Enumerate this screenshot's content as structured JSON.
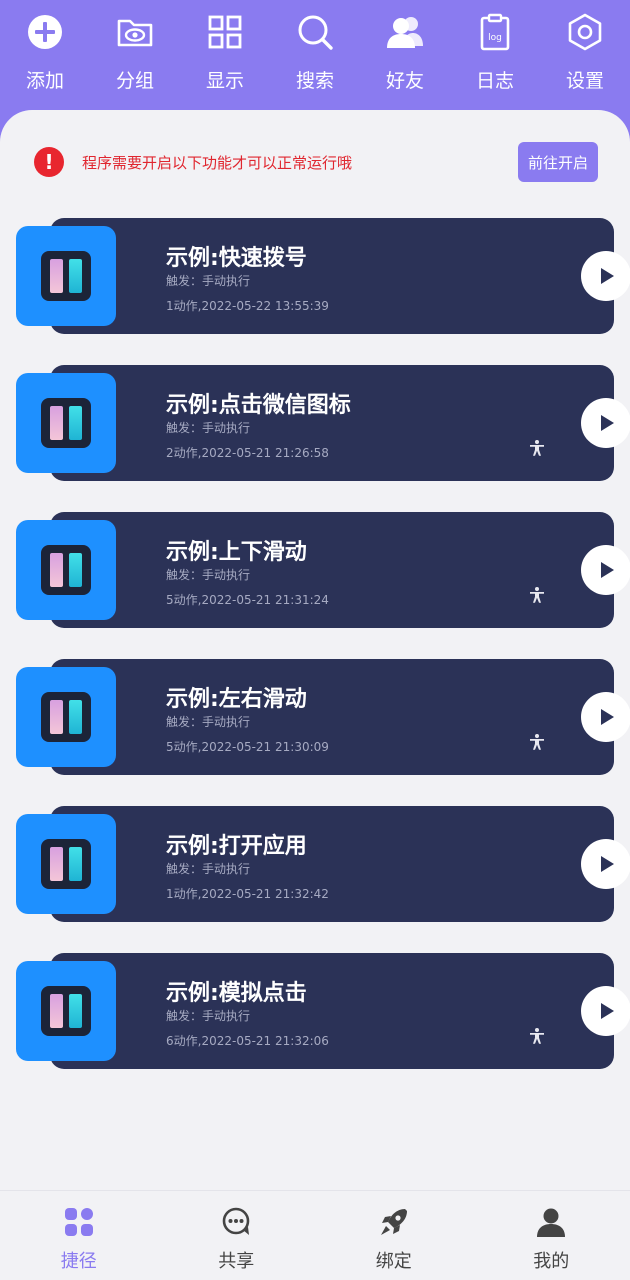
{
  "toolbar": {
    "items": [
      {
        "label": "添加",
        "icon": "plus-circle-icon"
      },
      {
        "label": "分组",
        "icon": "folder-eye-icon"
      },
      {
        "label": "显示",
        "icon": "grid-icon"
      },
      {
        "label": "搜索",
        "icon": "search-icon"
      },
      {
        "label": "好友",
        "icon": "friends-icon"
      },
      {
        "label": "日志",
        "icon": "log-clipboard-icon"
      },
      {
        "label": "设置",
        "icon": "settings-hexagon-icon"
      }
    ]
  },
  "notice": {
    "icon_text": "!",
    "text": "程序需要开启以下功能才可以正常运行哦",
    "button_label": "前往开启"
  },
  "cards": [
    {
      "title": "示例:快速拨号",
      "trigger": "触发：手动执行",
      "meta": "1动作,2022-05-22 13:55:39",
      "accessibility": false
    },
    {
      "title": "示例:点击微信图标",
      "trigger": "触发：手动执行",
      "meta": "2动作,2022-05-21 21:26:58",
      "accessibility": true
    },
    {
      "title": "示例:上下滑动",
      "trigger": "触发：手动执行",
      "meta": "5动作,2022-05-21 21:31:24",
      "accessibility": true
    },
    {
      "title": "示例:左右滑动",
      "trigger": "触发：手动执行",
      "meta": "5动作,2022-05-21 21:30:09",
      "accessibility": true
    },
    {
      "title": "示例:打开应用",
      "trigger": "触发：手动执行",
      "meta": "1动作,2022-05-21 21:32:42",
      "accessibility": false
    },
    {
      "title": "示例:模拟点击",
      "trigger": "触发：手动执行",
      "meta": "6动作,2022-05-21 21:32:06",
      "accessibility": true
    }
  ],
  "bottom_nav": {
    "items": [
      {
        "label": "捷径",
        "icon": "shortcuts-icon",
        "active": true
      },
      {
        "label": "共享",
        "icon": "share-chat-icon",
        "active": false
      },
      {
        "label": "绑定",
        "icon": "rocket-icon",
        "active": false
      },
      {
        "label": "我的",
        "icon": "profile-icon",
        "active": false
      }
    ]
  },
  "colors": {
    "accent": "#8a7bf0",
    "card_bg": "#2b3257",
    "thumb_bg": "#1e90ff",
    "warning": "#e8262f",
    "panel_bg": "#f2f2f5"
  }
}
